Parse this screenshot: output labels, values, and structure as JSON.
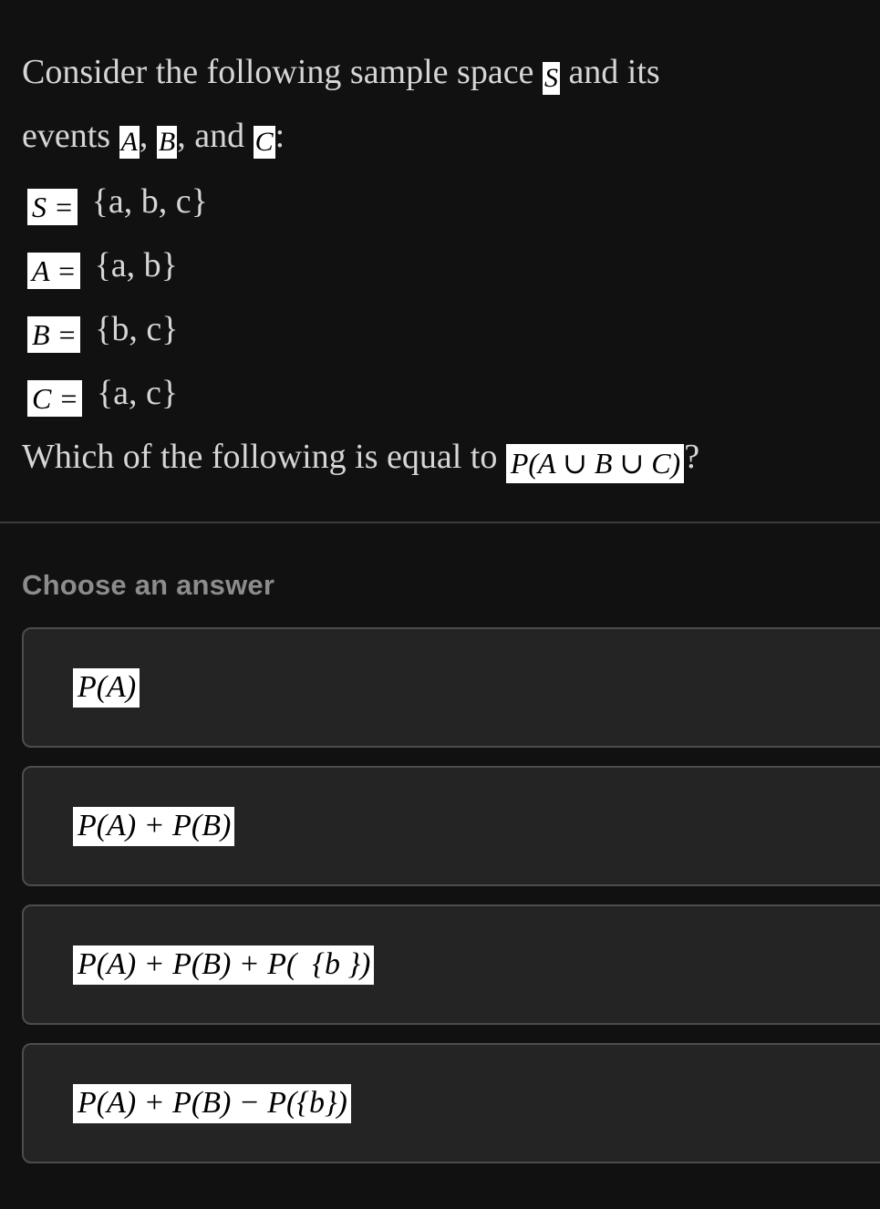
{
  "question": {
    "line1_before": "Consider the following sample space",
    "line1_symbol": "S",
    "line1_after": "and its",
    "line2_before": "events",
    "line2_sym_a": "A",
    "line2_comma1": ",",
    "line2_sym_b": "B",
    "line2_comma2": ", and",
    "line2_sym_c": "C",
    "line2_colon": ":",
    "definitions": [
      {
        "math": "S =",
        "value": "{a, b, c}"
      },
      {
        "math": "A =",
        "value": "{a, b}"
      },
      {
        "math": "B =",
        "value": "{b, c}"
      },
      {
        "math": "C =",
        "value": "{a, c}"
      }
    ],
    "prompt_before": "Which of the following is equal to",
    "prompt_math": "P(A ∪ B ∪ C)",
    "prompt_after": "?"
  },
  "answers": {
    "header": "Choose an answer",
    "options": [
      {
        "math": "P(A)"
      },
      {
        "math": "P(A) + P(B)"
      },
      {
        "math": "P(A) + P(B) + P(  {b })"
      },
      {
        "math": "P(A) + P(B) − P({b})"
      }
    ]
  },
  "colors": {
    "page_background": "#111111",
    "card_background": "#242424",
    "card_border": "#4d4d4d",
    "body_text": "#d6d6d6",
    "header_text": "#8c8c8c",
    "divider": "#3b3b3b",
    "math_background": "#ffffff",
    "math_text": "#000000"
  }
}
